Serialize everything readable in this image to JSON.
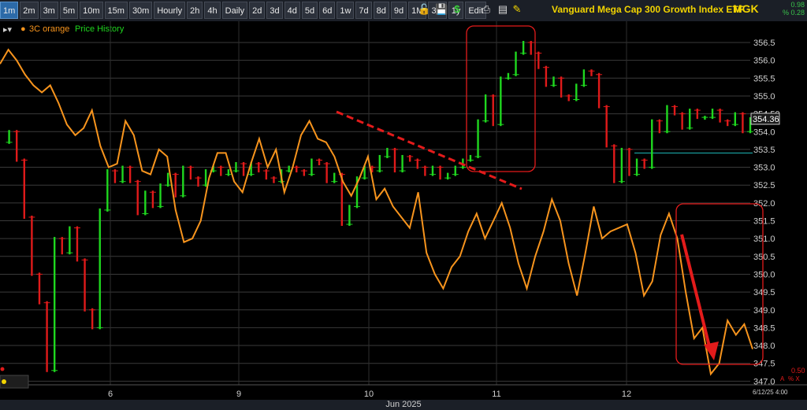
{
  "toolbar": {
    "timeframes": [
      "1m",
      "2m",
      "3m",
      "5m",
      "10m",
      "15m",
      "30m",
      "Hourly",
      "2h",
      "4h",
      "Daily",
      "2d",
      "3d",
      "4d",
      "5d",
      "6d",
      "1w",
      "7d",
      "8d",
      "9d",
      "1M",
      "3M",
      "1y",
      "Edit"
    ],
    "active": "1m",
    "icons": [
      "lock-icon",
      "save-icon",
      "dollar-icon",
      "print-icon",
      "pencil-icon"
    ]
  },
  "header": {
    "title": "Vanguard Mega Cap 300 Growth Index ETF",
    "symbol": "MGK",
    "change_value": "0.98",
    "change_pct": "% 0.28"
  },
  "legend": {
    "series1": "3C orange",
    "series2": "Price History"
  },
  "colors": {
    "orange": "#f7941d",
    "up": "#1fd71f",
    "down": "#e01a1a",
    "annotation": "#e31b1b",
    "grid": "#3a3a3a"
  },
  "chart_data": {
    "type": "line",
    "xlabel": "Jun 2025",
    "x_ticks": [
      "6",
      "9",
      "10",
      "11",
      "12"
    ],
    "y_ticks": [
      "356.5",
      "356.0",
      "355.5",
      "355.0",
      "354.50",
      "354.0",
      "353.5",
      "353.0",
      "352.5",
      "352.0",
      "351.5",
      "351.0",
      "350.5",
      "350.0",
      "349.5",
      "349.0",
      "348.5",
      "348.0",
      "347.5",
      "347.0"
    ],
    "ylim": [
      347.0,
      356.5
    ],
    "last_price": "354.36",
    "flat_line": 353.4,
    "lower_pct": "0.50",
    "corner_date": "6/12/25 4:00",
    "sub_labels": [
      "A",
      "% X"
    ],
    "series": [
      {
        "name": "3C orange",
        "values": [
          355.9,
          356.3,
          356.0,
          355.6,
          355.3,
          355.1,
          355.3,
          354.8,
          354.2,
          353.9,
          354.1,
          354.6,
          353.6,
          353.0,
          353.1,
          354.3,
          353.9,
          352.9,
          352.8,
          353.5,
          353.3,
          351.8,
          350.9,
          351.0,
          351.5,
          352.7,
          353.4,
          353.4,
          352.6,
          352.3,
          353.1,
          353.8,
          353.0,
          353.5,
          352.3,
          353.0,
          353.9,
          354.3,
          353.8,
          353.7,
          353.3,
          352.6,
          352.2,
          352.7,
          353.3,
          352.1,
          352.4,
          351.9,
          351.6,
          351.3,
          352.3,
          350.6,
          350.0,
          349.6,
          350.2,
          350.5,
          351.2,
          351.7,
          351.0,
          351.5,
          352.0,
          351.3,
          350.3,
          349.6,
          350.5,
          351.2,
          352.1,
          351.5,
          350.3,
          349.4,
          350.6,
          351.9,
          351.0,
          351.2,
          351.3,
          351.4,
          350.6,
          349.4,
          349.8,
          351.1,
          351.7,
          351.0,
          349.5,
          348.2,
          348.5,
          347.2,
          347.5,
          348.7,
          348.3,
          348.6,
          347.9
        ]
      },
      {
        "name": "Price History",
        "values": [
          353.7,
          354.0,
          353.2,
          351.6,
          350.0,
          349.2,
          347.3,
          351.0,
          350.6,
          351.3,
          350.4,
          349.0,
          348.5,
          351.8,
          352.9,
          352.6,
          353.0,
          352.6,
          351.7,
          352.3,
          351.9,
          352.5,
          352.8,
          352.2,
          353.0,
          352.7,
          352.5,
          352.9,
          353.0,
          352.8,
          352.9,
          353.1,
          352.8,
          353.1,
          352.9,
          352.7,
          352.6,
          352.9,
          353.0,
          352.9,
          352.8,
          353.2,
          353.1,
          352.6,
          352.8,
          351.4,
          351.9,
          352.7,
          353.0,
          352.9,
          353.3,
          353.5,
          352.9,
          353.3,
          353.2,
          353.0,
          352.8,
          353.0,
          352.7,
          352.8,
          353.0,
          353.2,
          353.3,
          354.3,
          355.0,
          354.2,
          355.5,
          355.6,
          356.2,
          356.5,
          356.2,
          355.8,
          355.3,
          355.5,
          355.0,
          354.9,
          355.3,
          355.7,
          355.6,
          354.7,
          353.6,
          352.6,
          353.5,
          352.8,
          353.2,
          353.0,
          354.3,
          354.0,
          354.7,
          354.5,
          354.1,
          354.6,
          354.4,
          354.4,
          354.6,
          354.3,
          354.2,
          354.5,
          354.0,
          354.36
        ]
      }
    ]
  }
}
